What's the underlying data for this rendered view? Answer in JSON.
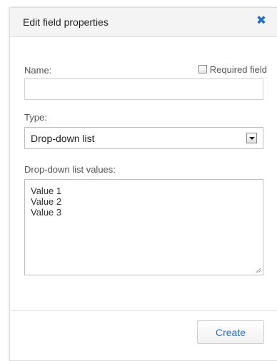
{
  "dialog": {
    "title": "Edit field properties",
    "close_icon": "close-icon",
    "accent_color": "#2a6fc9"
  },
  "form": {
    "name_label": "Name:",
    "name_value": "",
    "required_label": "Required field",
    "required_checked": false,
    "type_label": "Type:",
    "type_selected": "Drop-down list",
    "values_label": "Drop-down list values:",
    "values_lines": [
      "Value 1",
      "Value 2",
      "Value 3"
    ]
  },
  "footer": {
    "create_label": "Create"
  }
}
